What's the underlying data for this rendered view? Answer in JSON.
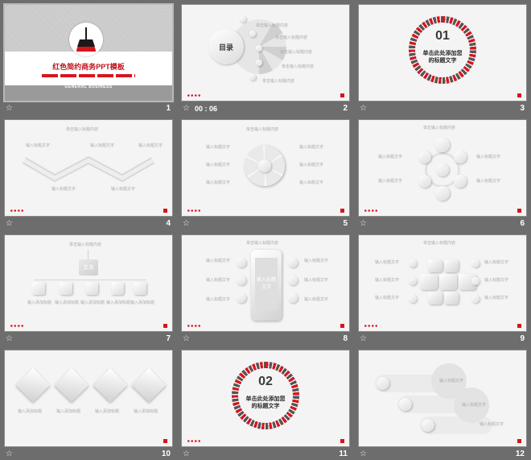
{
  "colors": {
    "background": "#6d6d6d",
    "accent": "#d6161d",
    "slide": "#f4f4f5"
  },
  "slides": [
    {
      "number": "1",
      "title": "红色简约商务PPT模板",
      "subtitle": "GENERAL BUSINESS",
      "timing": ""
    },
    {
      "number": "2",
      "title": "目录",
      "timing": "00 : 06",
      "items": [
        "单击输入标题内容",
        "单击输入标题内容",
        "单击输入标题内容",
        "单击输入标题内容",
        "单击输入标题内容",
        "单击输入标题内容"
      ],
      "letters": [
        "A",
        "B",
        "C",
        "D",
        "E",
        "F"
      ]
    },
    {
      "number": "3",
      "section": "01",
      "caption_line1": "单击此处添加您",
      "caption_line2": "的标题文字"
    },
    {
      "number": "4",
      "heading": "单击输入标题内容",
      "label": "输入标题文字"
    },
    {
      "number": "5",
      "heading": "单击输入标题内容",
      "label": "输入标题文字"
    },
    {
      "number": "6",
      "heading": "单击输入标题内容",
      "label": "输入标题文字"
    },
    {
      "number": "7",
      "heading": "单击输入标题内容",
      "center": "文本",
      "label": "输入添加标题"
    },
    {
      "number": "8",
      "heading": "单击输入标题内容",
      "phone_text": "输入标题文字",
      "label": "输入标题文字",
      "nums": [
        "01",
        "02",
        "03",
        "04",
        "05",
        "06"
      ]
    },
    {
      "number": "9",
      "heading": "单击输入标题内容",
      "label": "输入标题文字",
      "nums": [
        "01",
        "02",
        "03",
        "04",
        "05",
        "06"
      ]
    },
    {
      "number": "10",
      "label": "输入添加标题"
    },
    {
      "number": "11",
      "section": "02",
      "caption_line1": "单击此处添加您",
      "caption_line2": "的标题文字"
    },
    {
      "number": "12",
      "label": "输入标题文字"
    }
  ],
  "icons": {
    "star": "☆"
  }
}
